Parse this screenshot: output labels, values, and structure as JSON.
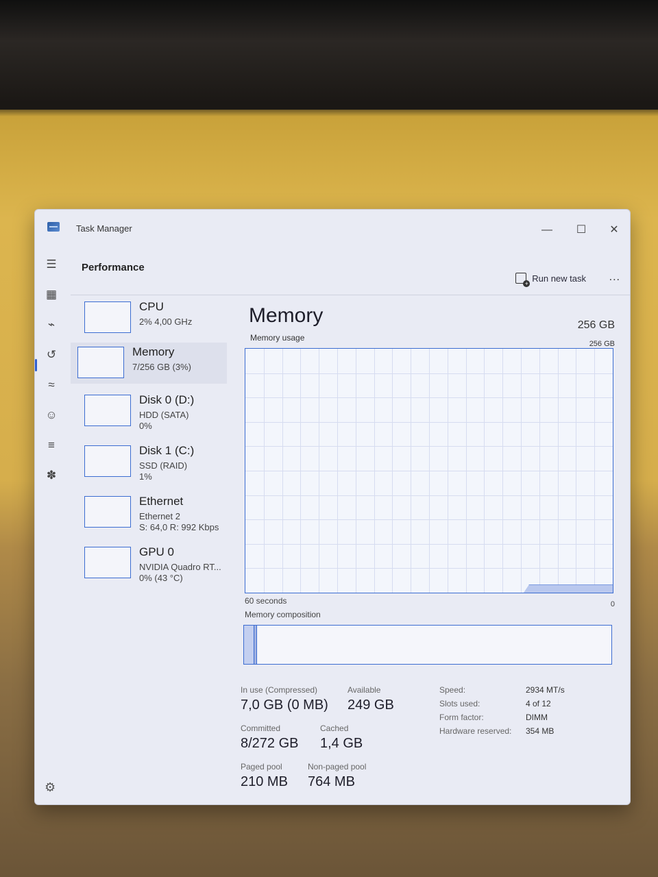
{
  "window": {
    "title": "Task Manager"
  },
  "nav": {
    "items": [
      {
        "icon": "hamburger-menu-icon",
        "glyph": "☰"
      },
      {
        "icon": "processes-icon",
        "glyph": "▦"
      },
      {
        "icon": "performance-icon",
        "glyph": "⌁"
      },
      {
        "icon": "app-history-icon",
        "glyph": "↺"
      },
      {
        "icon": "startup-apps-icon",
        "glyph": "≈"
      },
      {
        "icon": "users-icon",
        "glyph": "☺"
      },
      {
        "icon": "details-icon",
        "glyph": "≡"
      },
      {
        "icon": "services-icon",
        "glyph": "✽"
      }
    ],
    "settings_glyph": "⚙"
  },
  "header": {
    "title": "Performance",
    "run_new_task": "Run new task",
    "more": "..."
  },
  "resources": [
    {
      "name": "CPU",
      "sub1": "2% 4,00 GHz",
      "sub2": ""
    },
    {
      "name": "Memory",
      "sub1": "7/256 GB (3%)",
      "sub2": ""
    },
    {
      "name": "Disk 0 (D:)",
      "sub1": "HDD (SATA)",
      "sub2": "0%"
    },
    {
      "name": "Disk 1 (C:)",
      "sub1": "SSD (RAID)",
      "sub2": "1%"
    },
    {
      "name": "Ethernet",
      "sub1": "Ethernet 2",
      "sub2": "S: 64,0 R: 992 Kbps"
    },
    {
      "name": "GPU 0",
      "sub1": "NVIDIA Quadro RT...",
      "sub2": "0% (43 °C)"
    }
  ],
  "memory": {
    "title": "Memory",
    "total": "256 GB",
    "usage_label": "Memory usage",
    "usage_max": "256 GB",
    "time_label": "60 seconds",
    "zero_label": "0",
    "composition_label": "Memory composition",
    "usage_fraction": 0.03,
    "stats": {
      "in_use_label": "In use (Compressed)",
      "in_use_value": "7,0 GB (0 MB)",
      "available_label": "Available",
      "available_value": "249 GB",
      "committed_label": "Committed",
      "committed_value": "8/272 GB",
      "cached_label": "Cached",
      "cached_value": "1,4 GB",
      "paged_pool_label": "Paged pool",
      "paged_pool_value": "210 MB",
      "nonpaged_pool_label": "Non-paged pool",
      "nonpaged_pool_value": "764 MB"
    },
    "details": [
      {
        "key": "Speed:",
        "value": "2934 MT/s"
      },
      {
        "key": "Slots used:",
        "value": "4 of 12"
      },
      {
        "key": "Form factor:",
        "value": "DIMM"
      },
      {
        "key": "Hardware reserved:",
        "value": "354 MB"
      }
    ]
  },
  "colors": {
    "accent": "#3b6cd1",
    "window_bg": "#e9ebf4"
  }
}
